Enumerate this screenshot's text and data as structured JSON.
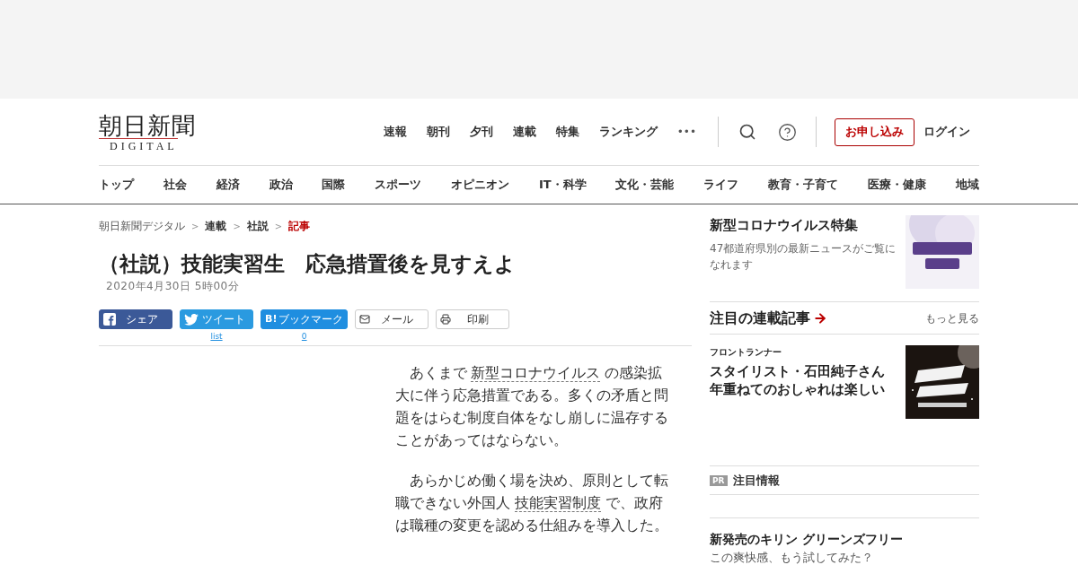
{
  "logo": {
    "title": "朝日新聞",
    "subtitle": "DIGITAL"
  },
  "top_nav": [
    "速報",
    "朝刊",
    "夕刊",
    "連載",
    "特集",
    "ランキング"
  ],
  "header_actions": {
    "more": "•••",
    "apply": "お申し込み",
    "login": "ログイン"
  },
  "categories": [
    "トップ",
    "社会",
    "経済",
    "政治",
    "国際",
    "スポーツ",
    "オピニオン",
    "IT・科学",
    "文化・芸能",
    "ライフ",
    "教育・子育て",
    "医療・健康",
    "地域"
  ],
  "breadcrumbs": [
    {
      "label": "朝日新聞デジタル",
      "selected": false
    },
    {
      "label": "連載",
      "selected": false
    },
    {
      "label": "社説",
      "selected": false
    },
    {
      "label": "記事",
      "selected": true
    }
  ],
  "breadcrumb_separator": ">",
  "article": {
    "title": "（社説）技能実習生　応急措置後を見すえよ",
    "date": "2020年4月30日 5時00分",
    "share": [
      {
        "kind": "facebook",
        "label": "シェア"
      },
      {
        "kind": "twitter",
        "label": "ツイート",
        "count": "list"
      },
      {
        "kind": "hatena",
        "label": "ブックマーク",
        "icon": "B!",
        "count": "0"
      },
      {
        "kind": "mail",
        "label": "メール"
      },
      {
        "kind": "print",
        "label": "印刷"
      }
    ],
    "paragraphs": [
      [
        {
          "text": "あくまで ",
          "link": false
        },
        {
          "text": "新型コロナウイルス",
          "link": true
        },
        {
          "text": " の感染拡大に伴う応急措置である。多くの矛盾と問題をはらむ制度自体をなし崩しに温存することがあってはならない。",
          "link": false
        }
      ],
      [
        {
          "text": "あらかじめ働く場を決め、原則として転職できない外国人 ",
          "link": false
        },
        {
          "text": "技能実習制度",
          "link": true
        },
        {
          "text": " で、政府は職種の変更を認める仕組みを導入した。",
          "link": false
        }
      ]
    ]
  },
  "sidebar": {
    "feature": {
      "title": "新型コロナウイルス特集",
      "description": "47都道府県別の最新ニュースがご覧になれます"
    },
    "series": {
      "heading": "注目の連載記事",
      "more": "もっと見る",
      "items": [
        {
          "category": "フロントランナー",
          "title": "スタイリスト・石田純子さん年重ねてのおしゃれは楽しい"
        }
      ]
    },
    "pr": {
      "badge": "PR",
      "heading": "注目情報",
      "items": [
        {
          "title": "新発売のキリン グリーンズフリー",
          "description": "この爽快感、もう試してみた？"
        }
      ]
    }
  }
}
